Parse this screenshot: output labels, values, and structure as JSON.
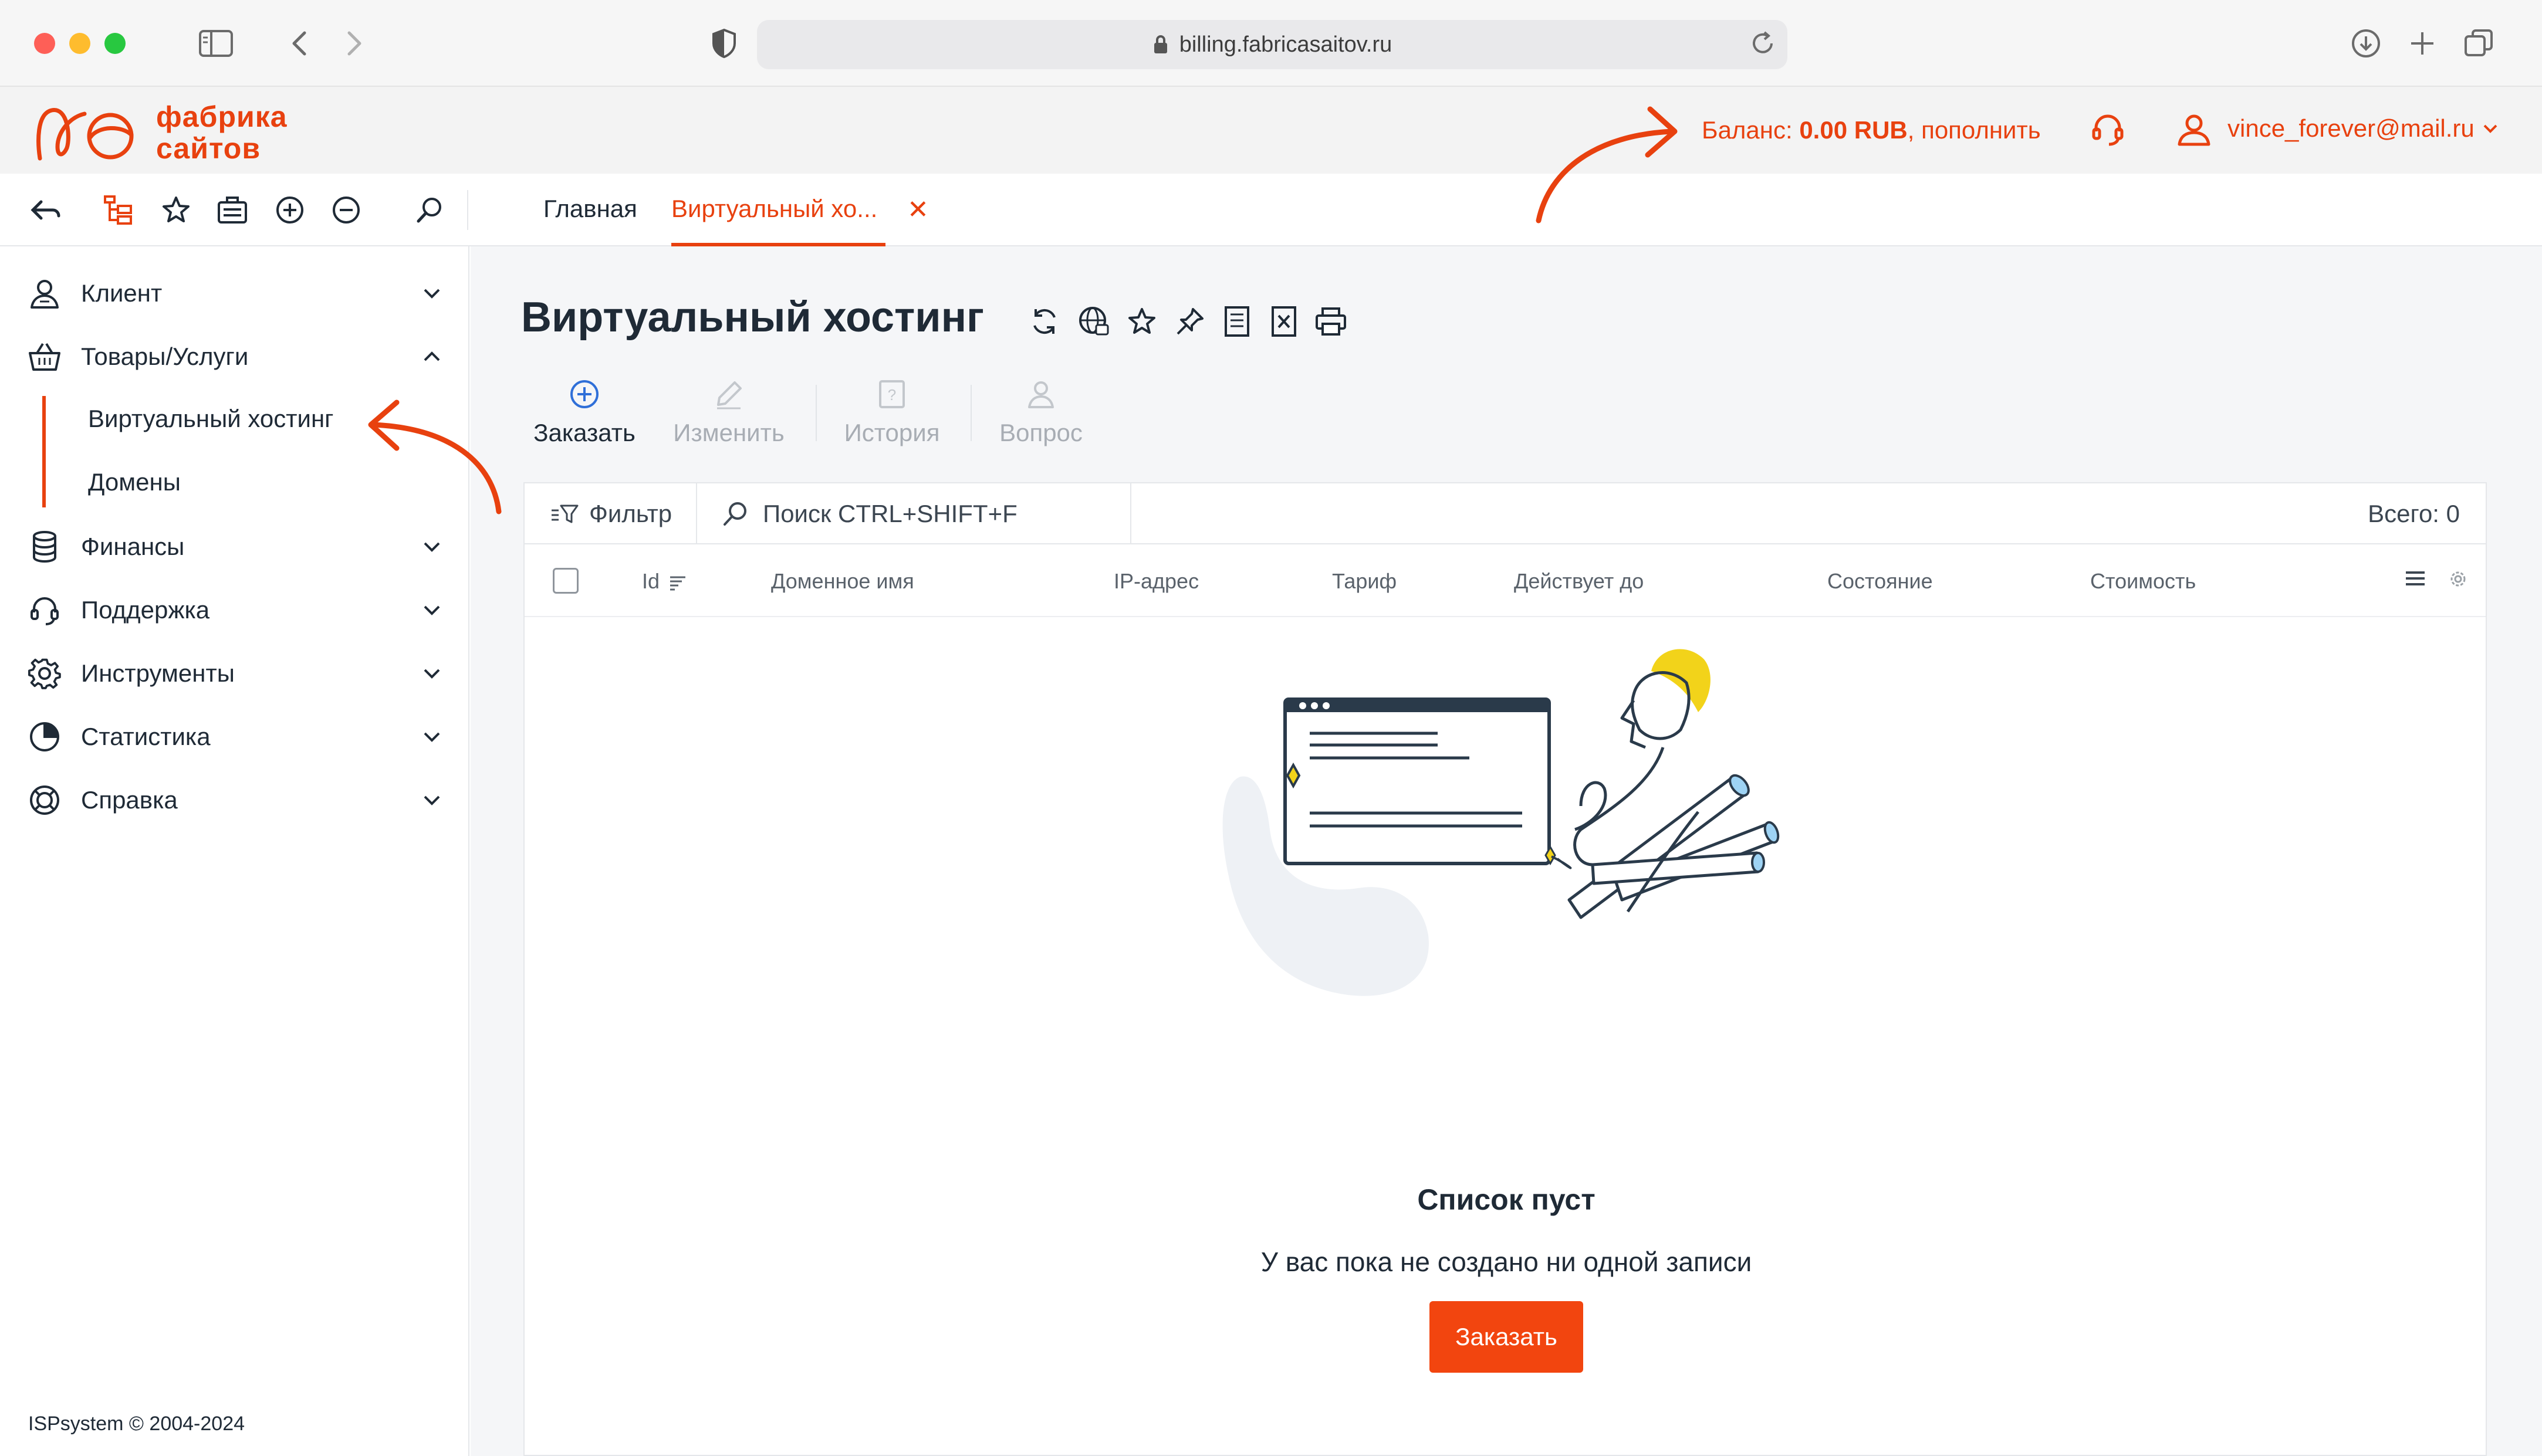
{
  "browser": {
    "url": "billing.fabricasaitov.ru"
  },
  "header": {
    "logo_line1": "фабрика",
    "logo_line2": "сайтов",
    "balance_label": "Баланс:",
    "balance_value": "0.00 RUB",
    "balance_action": ", пополнить",
    "user_email": "vince_forever@mail.ru"
  },
  "tabs": [
    {
      "label": "Главная"
    },
    {
      "label": "Виртуальный хо..."
    }
  ],
  "sidebar": {
    "items": [
      {
        "label": "Клиент",
        "icon": "user-icon",
        "expanded": false
      },
      {
        "label": "Товары/Услуги",
        "icon": "basket-icon",
        "expanded": true
      },
      {
        "label": "Финансы",
        "icon": "coins-icon",
        "expanded": false
      },
      {
        "label": "Поддержка",
        "icon": "headset-icon",
        "expanded": false
      },
      {
        "label": "Инструменты",
        "icon": "gear-icon",
        "expanded": false
      },
      {
        "label": "Статистика",
        "icon": "pie-chart-icon",
        "expanded": false
      },
      {
        "label": "Справка",
        "icon": "lifebuoy-icon",
        "expanded": false
      }
    ],
    "subitems": [
      {
        "label": "Виртуальный хостинг",
        "active": true
      },
      {
        "label": "Домены",
        "active": false
      }
    ],
    "copyright": "ISPsystem © 2004-2024"
  },
  "page": {
    "title": "Виртуальный хостинг",
    "actions": [
      {
        "label": "Заказать",
        "enabled": true
      },
      {
        "label": "Изменить",
        "enabled": false
      },
      {
        "label": "История",
        "enabled": false
      },
      {
        "label": "Вопрос",
        "enabled": false
      }
    ]
  },
  "grid": {
    "filter_label": "Фильтр",
    "search_placeholder": "Поиск CTRL+SHIFT+F",
    "total": "Всего: 0",
    "columns": [
      "Id",
      "Доменное имя",
      "IP-адрес",
      "Тариф",
      "Действует до",
      "Состояние",
      "Стоимость"
    ],
    "empty_title": "Список пуст",
    "empty_subtitle": "У вас пока не создано ни одной записи",
    "order_button": "Заказать"
  },
  "colors": {
    "accent": "#e8410f",
    "button": "#f2450f",
    "text": "#1f2a36",
    "disabled": "#a8adb4"
  }
}
